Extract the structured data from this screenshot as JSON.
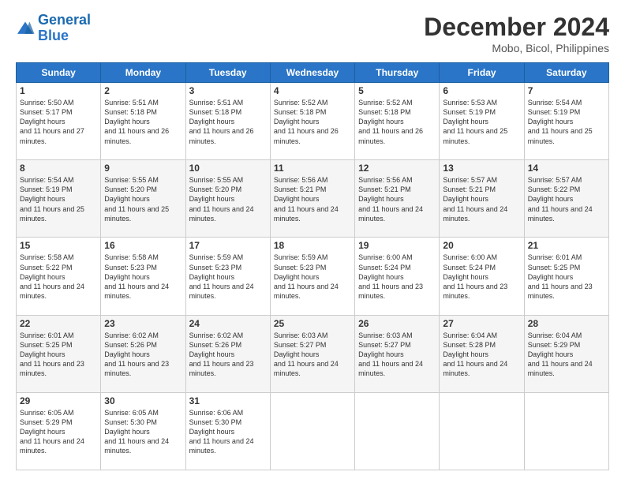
{
  "logo": {
    "line1": "General",
    "line2": "Blue"
  },
  "title": "December 2024",
  "subtitle": "Mobo, Bicol, Philippines",
  "days_header": [
    "Sunday",
    "Monday",
    "Tuesday",
    "Wednesday",
    "Thursday",
    "Friday",
    "Saturday"
  ],
  "weeks": [
    [
      {
        "day": "1",
        "sun": "5:50 AM",
        "set": "5:17 PM",
        "dh": "11 hours and 27 minutes."
      },
      {
        "day": "2",
        "sun": "5:51 AM",
        "set": "5:18 PM",
        "dh": "11 hours and 26 minutes."
      },
      {
        "day": "3",
        "sun": "5:51 AM",
        "set": "5:18 PM",
        "dh": "11 hours and 26 minutes."
      },
      {
        "day": "4",
        "sun": "5:52 AM",
        "set": "5:18 PM",
        "dh": "11 hours and 26 minutes."
      },
      {
        "day": "5",
        "sun": "5:52 AM",
        "set": "5:18 PM",
        "dh": "11 hours and 26 minutes."
      },
      {
        "day": "6",
        "sun": "5:53 AM",
        "set": "5:19 PM",
        "dh": "11 hours and 25 minutes."
      },
      {
        "day": "7",
        "sun": "5:54 AM",
        "set": "5:19 PM",
        "dh": "11 hours and 25 minutes."
      }
    ],
    [
      {
        "day": "8",
        "sun": "5:54 AM",
        "set": "5:19 PM",
        "dh": "11 hours and 25 minutes."
      },
      {
        "day": "9",
        "sun": "5:55 AM",
        "set": "5:20 PM",
        "dh": "11 hours and 25 minutes."
      },
      {
        "day": "10",
        "sun": "5:55 AM",
        "set": "5:20 PM",
        "dh": "11 hours and 24 minutes."
      },
      {
        "day": "11",
        "sun": "5:56 AM",
        "set": "5:21 PM",
        "dh": "11 hours and 24 minutes."
      },
      {
        "day": "12",
        "sun": "5:56 AM",
        "set": "5:21 PM",
        "dh": "11 hours and 24 minutes."
      },
      {
        "day": "13",
        "sun": "5:57 AM",
        "set": "5:21 PM",
        "dh": "11 hours and 24 minutes."
      },
      {
        "day": "14",
        "sun": "5:57 AM",
        "set": "5:22 PM",
        "dh": "11 hours and 24 minutes."
      }
    ],
    [
      {
        "day": "15",
        "sun": "5:58 AM",
        "set": "5:22 PM",
        "dh": "11 hours and 24 minutes."
      },
      {
        "day": "16",
        "sun": "5:58 AM",
        "set": "5:23 PM",
        "dh": "11 hours and 24 minutes."
      },
      {
        "day": "17",
        "sun": "5:59 AM",
        "set": "5:23 PM",
        "dh": "11 hours and 24 minutes."
      },
      {
        "day": "18",
        "sun": "5:59 AM",
        "set": "5:23 PM",
        "dh": "11 hours and 24 minutes."
      },
      {
        "day": "19",
        "sun": "6:00 AM",
        "set": "5:24 PM",
        "dh": "11 hours and 23 minutes."
      },
      {
        "day": "20",
        "sun": "6:00 AM",
        "set": "5:24 PM",
        "dh": "11 hours and 23 minutes."
      },
      {
        "day": "21",
        "sun": "6:01 AM",
        "set": "5:25 PM",
        "dh": "11 hours and 23 minutes."
      }
    ],
    [
      {
        "day": "22",
        "sun": "6:01 AM",
        "set": "5:25 PM",
        "dh": "11 hours and 23 minutes."
      },
      {
        "day": "23",
        "sun": "6:02 AM",
        "set": "5:26 PM",
        "dh": "11 hours and 23 minutes."
      },
      {
        "day": "24",
        "sun": "6:02 AM",
        "set": "5:26 PM",
        "dh": "11 hours and 23 minutes."
      },
      {
        "day": "25",
        "sun": "6:03 AM",
        "set": "5:27 PM",
        "dh": "11 hours and 24 minutes."
      },
      {
        "day": "26",
        "sun": "6:03 AM",
        "set": "5:27 PM",
        "dh": "11 hours and 24 minutes."
      },
      {
        "day": "27",
        "sun": "6:04 AM",
        "set": "5:28 PM",
        "dh": "11 hours and 24 minutes."
      },
      {
        "day": "28",
        "sun": "6:04 AM",
        "set": "5:29 PM",
        "dh": "11 hours and 24 minutes."
      }
    ],
    [
      {
        "day": "29",
        "sun": "6:05 AM",
        "set": "5:29 PM",
        "dh": "11 hours and 24 minutes."
      },
      {
        "day": "30",
        "sun": "6:05 AM",
        "set": "5:30 PM",
        "dh": "11 hours and 24 minutes."
      },
      {
        "day": "31",
        "sun": "6:06 AM",
        "set": "5:30 PM",
        "dh": "11 hours and 24 minutes."
      },
      null,
      null,
      null,
      null
    ]
  ]
}
